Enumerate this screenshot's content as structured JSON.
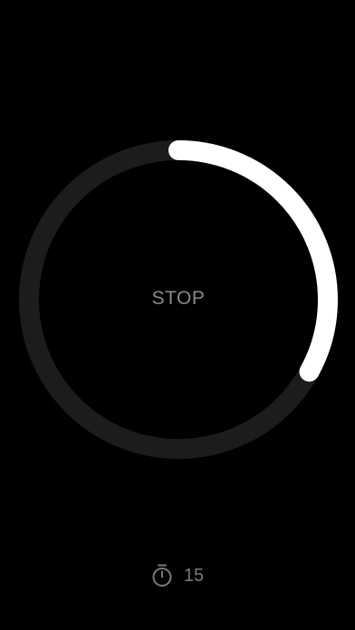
{
  "stopwatch": {
    "button_label": "STOP",
    "progress": 0.33,
    "track_color": "#1c1c1c",
    "progress_color": "#ffffff",
    "label_color": "#8a8a8a"
  },
  "footer": {
    "icon": "stopwatch-icon",
    "value": "15"
  }
}
